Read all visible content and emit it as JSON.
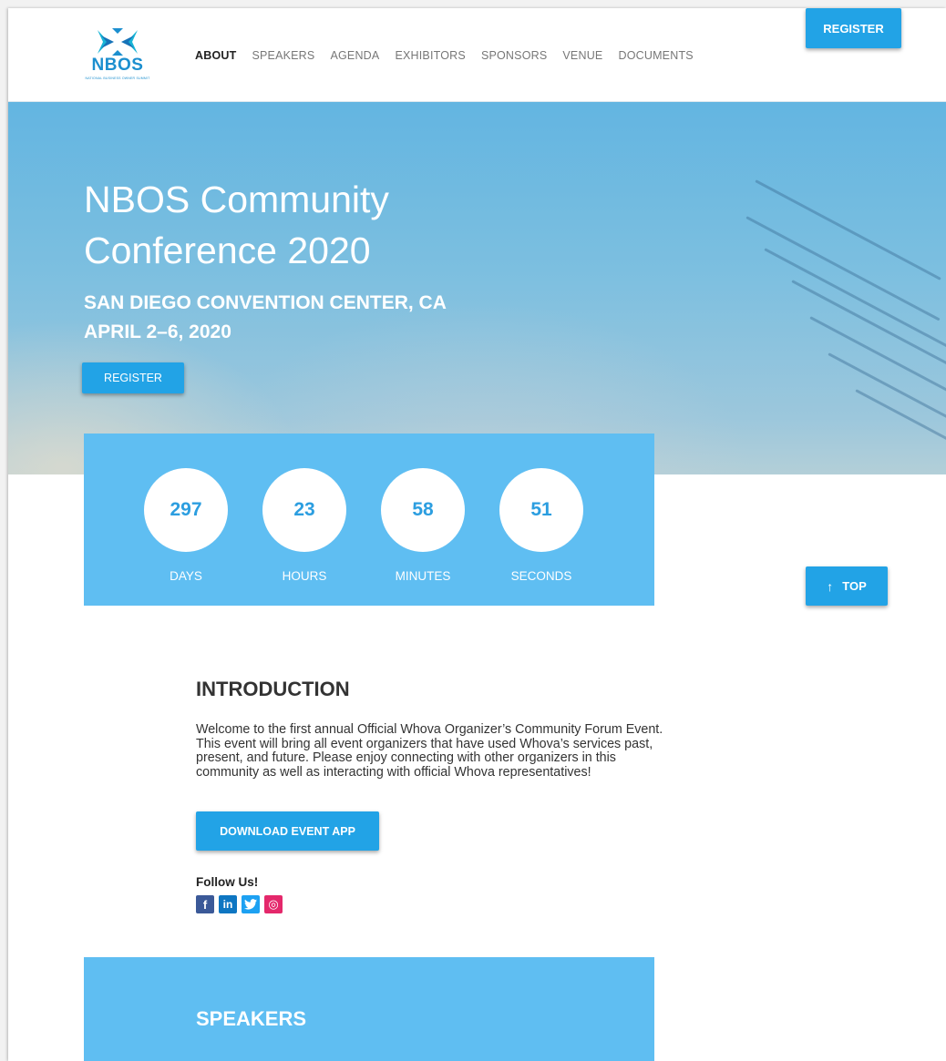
{
  "header": {
    "logo_text": "NBOS",
    "logo_subtext": "NATIONAL BUSINESS OWNER SUMMIT",
    "nav": [
      "ABOUT",
      "SPEAKERS",
      "AGENDA",
      "EXHIBITORS",
      "SPONSORS",
      "VENUE",
      "DOCUMENTS"
    ],
    "register_label": "REGISTER"
  },
  "hero": {
    "title": "NBOS Community Conference 2020",
    "location": "SAN DIEGO CONVENTION CENTER, CA",
    "dates": "APRIL 2–6, 2020",
    "register_label": "REGISTER"
  },
  "countdown": [
    {
      "value": "297",
      "label": "DAYS"
    },
    {
      "value": "23",
      "label": "HOURS"
    },
    {
      "value": "58",
      "label": "MINUTES"
    },
    {
      "value": "51",
      "label": "SECONDS"
    }
  ],
  "top_button": {
    "arrow": "↑",
    "label": "TOP"
  },
  "intro": {
    "title": "INTRODUCTION",
    "text_lines": [
      "Welcome to the first annual Official Whova Organizer’s Community Forum Event.",
      "This event will bring all event organizers that have used Whova’s services past,",
      "present, and future. Please enjoy connecting with other organizers in this",
      "community as well as interacting with official Whova representatives!"
    ],
    "download_label": "DOWNLOAD EVENT APP",
    "follow_title": "Follow Us!",
    "social": [
      {
        "icon": "facebook-icon",
        "glyph": "f",
        "color": "#3b5998"
      },
      {
        "icon": "linkedin-icon",
        "glyph": "in",
        "color": "#0e76c2"
      },
      {
        "icon": "twitter-icon",
        "glyph": "t",
        "color": "#1da1f2"
      },
      {
        "icon": "instagram-icon",
        "glyph": "◎",
        "color": "#e4286b"
      }
    ]
  },
  "speakers": {
    "title": "SPEAKERS"
  },
  "colors": {
    "accent": "#22a3e6",
    "panel": "#5fbef2"
  }
}
